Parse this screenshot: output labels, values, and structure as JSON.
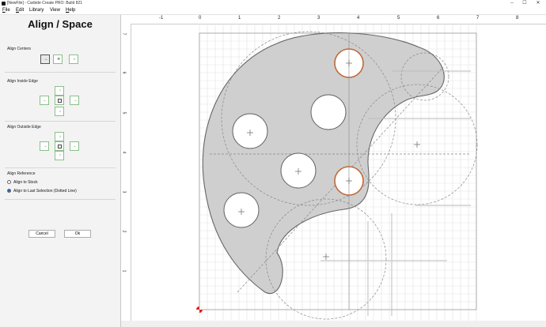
{
  "window": {
    "title": "[NewFile] - Carbide Create PRO: Build 821"
  },
  "menu": {
    "file": "ile",
    "file_u": "F",
    "edit": "dit",
    "edit_u": "E",
    "library": "Library",
    "view": "View",
    "help": "elp",
    "help_u": "H"
  },
  "panel": {
    "title": "Align / Space",
    "align_centers_label": "Align Centers",
    "align_inside_label": "Align Inside Edge",
    "align_outside_label": "Align Outside Edge",
    "align_reference_label": "Align Reference",
    "radio_stock": "Align to Stock",
    "radio_last": "Align to Last Selection (Dotted Line)",
    "selected_reference": "Align to Last Selection (Dotted Line)",
    "cancel_label": "Cancel",
    "ok_label": "Ok"
  },
  "ruler": {
    "x_labels": [
      "-1",
      "0",
      "1",
      "2",
      "3",
      "4",
      "5",
      "6",
      "7",
      "8"
    ],
    "y_labels": [
      "7",
      "6",
      "5",
      "4",
      "3",
      "2",
      "1"
    ]
  },
  "colors": {
    "selection": "#c06a3a",
    "shape_fill": "#cfcfcf",
    "shape_stroke": "#666666"
  }
}
